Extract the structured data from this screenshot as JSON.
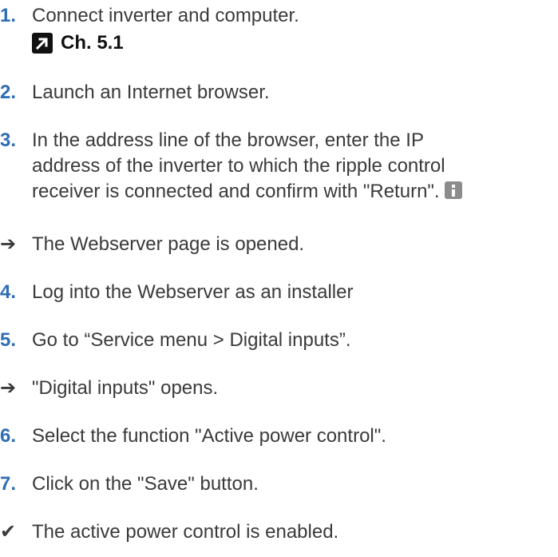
{
  "steps": [
    {
      "marker": "1.",
      "text": "Connect inverter and computer.",
      "ref": "Ch. 5.1"
    },
    {
      "marker": "2.",
      "text": "Launch an Internet browser."
    },
    {
      "marker": "3.",
      "lines": [
        "In the address line of the browser, enter the IP",
        "address of the inverter to which the ripple control",
        "receiver is connected and confirm with \"Return\"."
      ]
    },
    {
      "marker": "➔",
      "text": "The Webserver page is opened."
    },
    {
      "marker": "4.",
      "text": "Log into the Webserver as an installer"
    },
    {
      "marker": "5.",
      "text": "Go to “Service menu > Digital inputs”."
    },
    {
      "marker": "➔",
      "text": "\"Digital inputs\" opens."
    },
    {
      "marker": "6.",
      "text": "Select the function \"Active power control\"."
    },
    {
      "marker": "7.",
      "text": "Click on the \"Save\" button."
    },
    {
      "marker": "✔",
      "text": "The active power control is enabled."
    }
  ],
  "icons": {
    "reference": "external-link-arrow-icon",
    "info": "info-icon"
  },
  "colors": {
    "step_number": "#2e6db4",
    "text": "#3a3a3a",
    "info_icon": "#8c8c8c"
  }
}
